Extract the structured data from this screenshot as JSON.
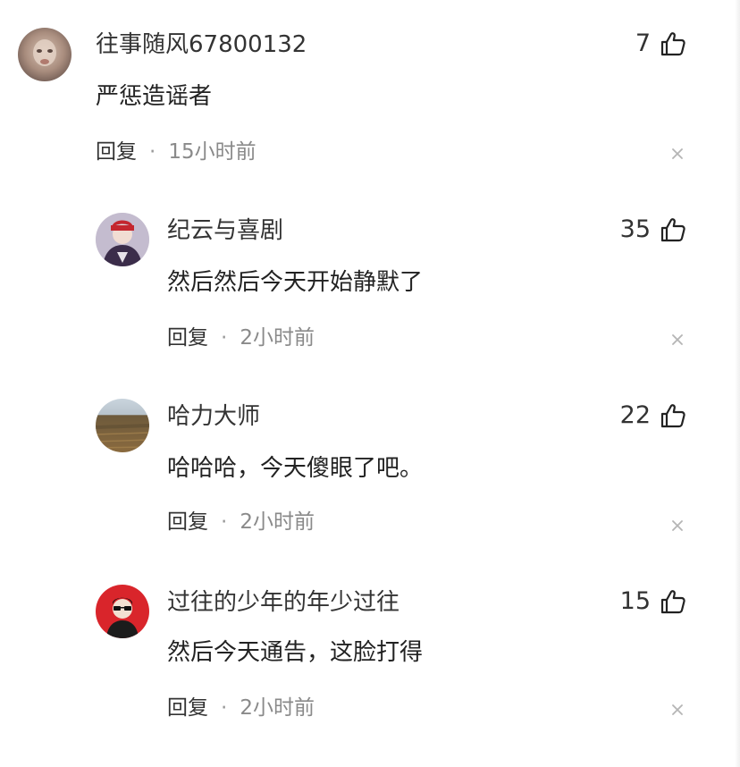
{
  "comments": [
    {
      "name": "往事随风67800132",
      "content": "严惩造谣者",
      "likes": "7",
      "reply_label": "回复",
      "separator": "·",
      "time": "15小时前"
    },
    {
      "name": "纪云与喜剧",
      "content": "然后然后今天开始静默了",
      "likes": "35",
      "reply_label": "回复",
      "separator": "·",
      "time": "2小时前"
    },
    {
      "name": "哈力大师",
      "content": "哈哈哈，今天傻眼了吧。",
      "likes": "22",
      "reply_label": "回复",
      "separator": "·",
      "time": "2小时前"
    },
    {
      "name": "过往的少年的年少过往",
      "content": "然后今天通告，这脸打得",
      "likes": "15",
      "reply_label": "回复",
      "separator": "·",
      "time": "2小时前"
    }
  ],
  "colors": {
    "text_primary": "#222222",
    "text_secondary": "#8a8a8a",
    "close_icon": "#b5b5b5"
  },
  "icons": {
    "like": "thumbs-up-icon",
    "close": "close-icon"
  }
}
